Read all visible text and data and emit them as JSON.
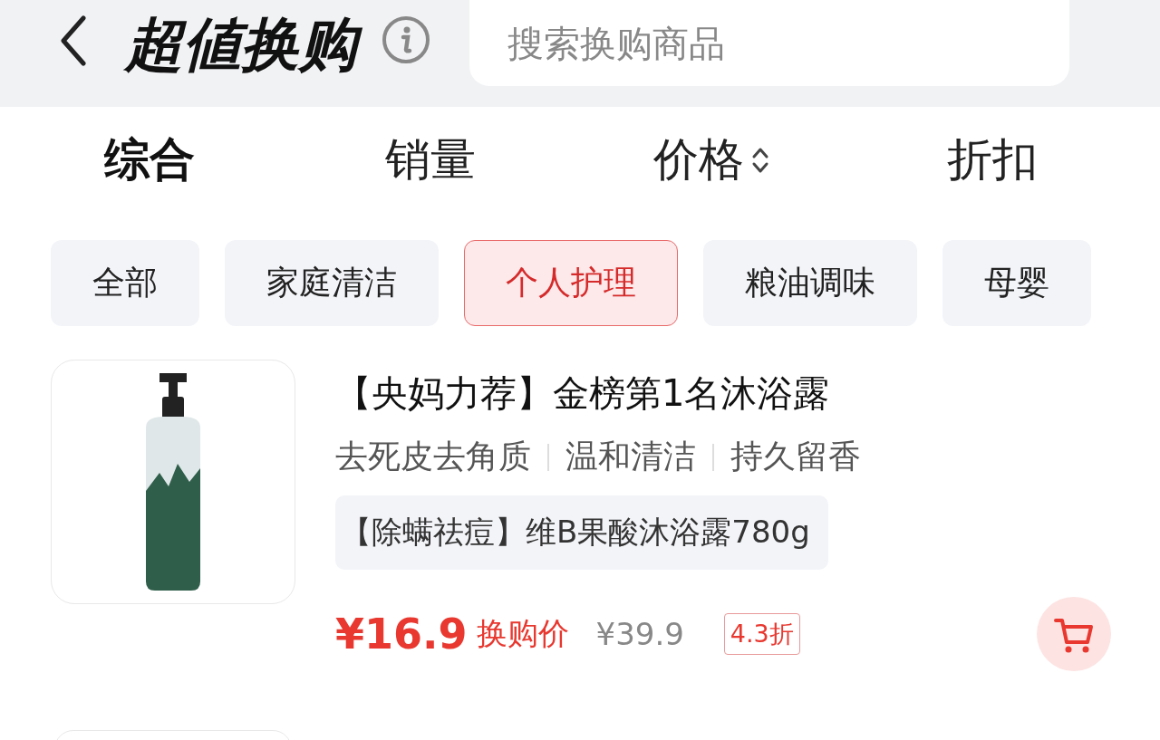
{
  "header": {
    "title": "超値换购",
    "search": {
      "placeholder": "搜索换购商品"
    }
  },
  "sort_tabs": [
    {
      "label": "综合",
      "selected": true,
      "kind": "plain"
    },
    {
      "label": "销量",
      "selected": false,
      "kind": "plain"
    },
    {
      "label": "价格",
      "selected": false,
      "kind": "sortable"
    },
    {
      "label": "折扣",
      "selected": false,
      "kind": "plain"
    }
  ],
  "categories": [
    {
      "label": "全部",
      "selected": false
    },
    {
      "label": "家庭清洁",
      "selected": false
    },
    {
      "label": "个人护理",
      "selected": true
    },
    {
      "label": "粮油调味",
      "selected": false
    },
    {
      "label": "母婴",
      "selected": false
    }
  ],
  "products": [
    {
      "title": "【央妈力荐】金榜第1名沐浴露",
      "tags": [
        "去死皮去角质",
        "温和清洁",
        "持久留香"
      ],
      "subtitle": "【除螨祛痘】维B果酸沐浴露780g",
      "price": "¥16.9",
      "price_label": "换购价",
      "original_price": "¥39.9",
      "discount": "4.3折"
    }
  ]
}
